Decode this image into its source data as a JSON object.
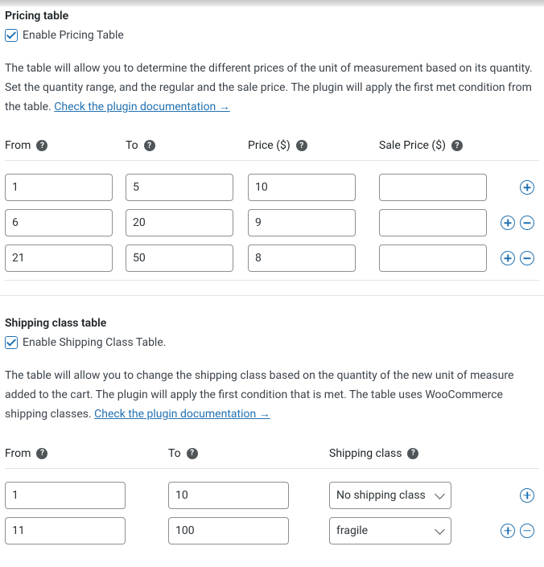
{
  "pricing": {
    "title": "Pricing table",
    "checkbox_label": "Enable Pricing Table",
    "description": "The table will allow you to determine the different prices of the unit of measurement based on its quantity. Set the quantity range, and the regular and the sale price. The plugin will apply the first met condition from the table.",
    "doc_link": "Check the plugin documentation",
    "headers": {
      "from": "From",
      "to": "To",
      "price": "Price ($)",
      "sale": "Sale Price ($)"
    },
    "rows": [
      {
        "from": "1",
        "to": "5",
        "price": "10",
        "sale": ""
      },
      {
        "from": "6",
        "to": "20",
        "price": "9",
        "sale": ""
      },
      {
        "from": "21",
        "to": "50",
        "price": "8",
        "sale": ""
      }
    ]
  },
  "shipping": {
    "title": "Shipping class table",
    "checkbox_label": "Enable Shipping Class Table.",
    "description": "The table will allow you to change the shipping class based on the quantity of the new unit of measure added to the cart. The plugin will apply the first condition that is met. The table uses WooCommerce shipping classes.",
    "doc_link": "Check the plugin documentation",
    "headers": {
      "from": "From",
      "to": "To",
      "ship": "Shipping class"
    },
    "rows": [
      {
        "from": "1",
        "to": "10",
        "ship": "No shipping class"
      },
      {
        "from": "11",
        "to": "100",
        "ship": "fragile"
      }
    ]
  },
  "help_glyph": "?"
}
